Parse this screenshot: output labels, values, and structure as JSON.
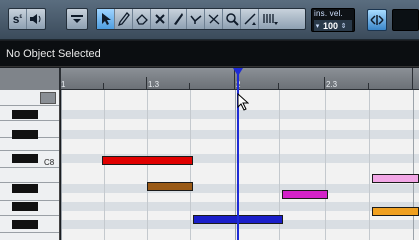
{
  "toolbar": {
    "buttons": [
      {
        "name": "solo-editor-button",
        "icon": "solo-s-icon"
      },
      {
        "name": "acoustic-feedback-button",
        "icon": "speaker-icon"
      },
      {
        "name": "show-info-button",
        "icon": "info-line-icon"
      },
      {
        "name": "object-selection-tool",
        "icon": "arrow-pointer-icon"
      },
      {
        "name": "draw-tool",
        "icon": "pencil-icon"
      },
      {
        "name": "erase-tool",
        "icon": "eraser-icon"
      },
      {
        "name": "trim-tool",
        "icon": "cross-icon"
      },
      {
        "name": "split-tool",
        "icon": "knife-icon"
      },
      {
        "name": "glue-tool",
        "icon": "glue-tube-icon"
      },
      {
        "name": "mute-tool",
        "icon": "mute-x-icon"
      },
      {
        "name": "zoom-tool",
        "icon": "magnifier-icon"
      },
      {
        "name": "line-tool",
        "icon": "line-icon"
      },
      {
        "name": "comb-tool",
        "icon": "comb-icon"
      }
    ],
    "insert_velocity_label": "ins. vel.",
    "insert_velocity_value": "100",
    "snap_icon": "snap-icon"
  },
  "status": {
    "text": "No Object Selected"
  },
  "ruler": {
    "labels": [
      "1",
      "1.3",
      "2",
      "2.3"
    ]
  },
  "keyboard": {
    "octave_label": "C8"
  },
  "colors": {
    "cursor": "#1e2bd6",
    "note_red": "#e00000",
    "note_brown": "#9a5a16",
    "note_magenta": "#d322c8",
    "note_blue": "#1a1ec9",
    "note_pink": "#f2a7e6",
    "note_orange": "#f0a020"
  },
  "notes": [
    {
      "color": "note_red"
    },
    {
      "color": "note_brown"
    },
    {
      "color": "note_magenta"
    },
    {
      "color": "note_blue"
    },
    {
      "color": "note_pink"
    },
    {
      "color": "note_orange"
    }
  ]
}
